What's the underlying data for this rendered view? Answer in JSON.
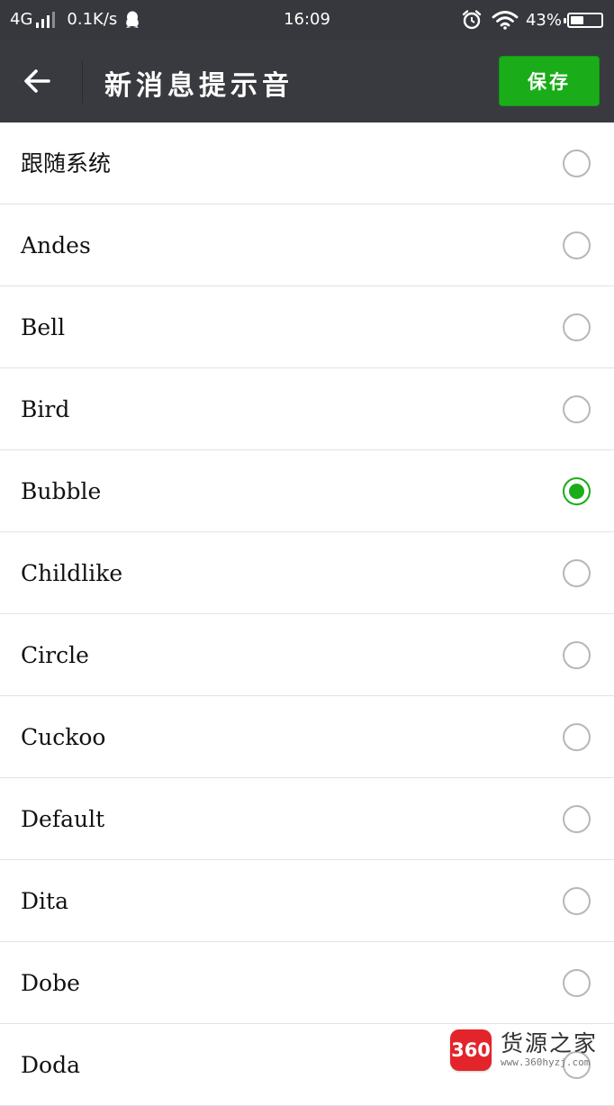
{
  "status_bar": {
    "network": "4G",
    "speed": "0.1K/s",
    "time": "16:09",
    "battery": "43%",
    "battery_level": 0.43,
    "icons": [
      "signal-icon",
      "qq-icon",
      "alarm-icon",
      "wifi-icon",
      "battery-icon"
    ]
  },
  "toolbar": {
    "title": "新消息提示音",
    "save_label": "保存",
    "back_icon": "back-arrow-icon"
  },
  "sounds": [
    {
      "label": "跟随系统",
      "selected": false
    },
    {
      "label": "Andes",
      "selected": false
    },
    {
      "label": "Bell",
      "selected": false
    },
    {
      "label": "Bird",
      "selected": false
    },
    {
      "label": "Bubble",
      "selected": true
    },
    {
      "label": "Childlike",
      "selected": false
    },
    {
      "label": "Circle",
      "selected": false
    },
    {
      "label": "Cuckoo",
      "selected": false
    },
    {
      "label": "Default",
      "selected": false
    },
    {
      "label": "Dita",
      "selected": false
    },
    {
      "label": "Dobe",
      "selected": false
    },
    {
      "label": "Doda",
      "selected": false
    }
  ],
  "watermark": {
    "badge": "360",
    "name": "货源之家",
    "url": "www.360hyzj.com"
  },
  "colors": {
    "accent_green": "#1aad19",
    "toolbar_bg": "#393a3f",
    "statusbar_bg": "#36383d"
  }
}
